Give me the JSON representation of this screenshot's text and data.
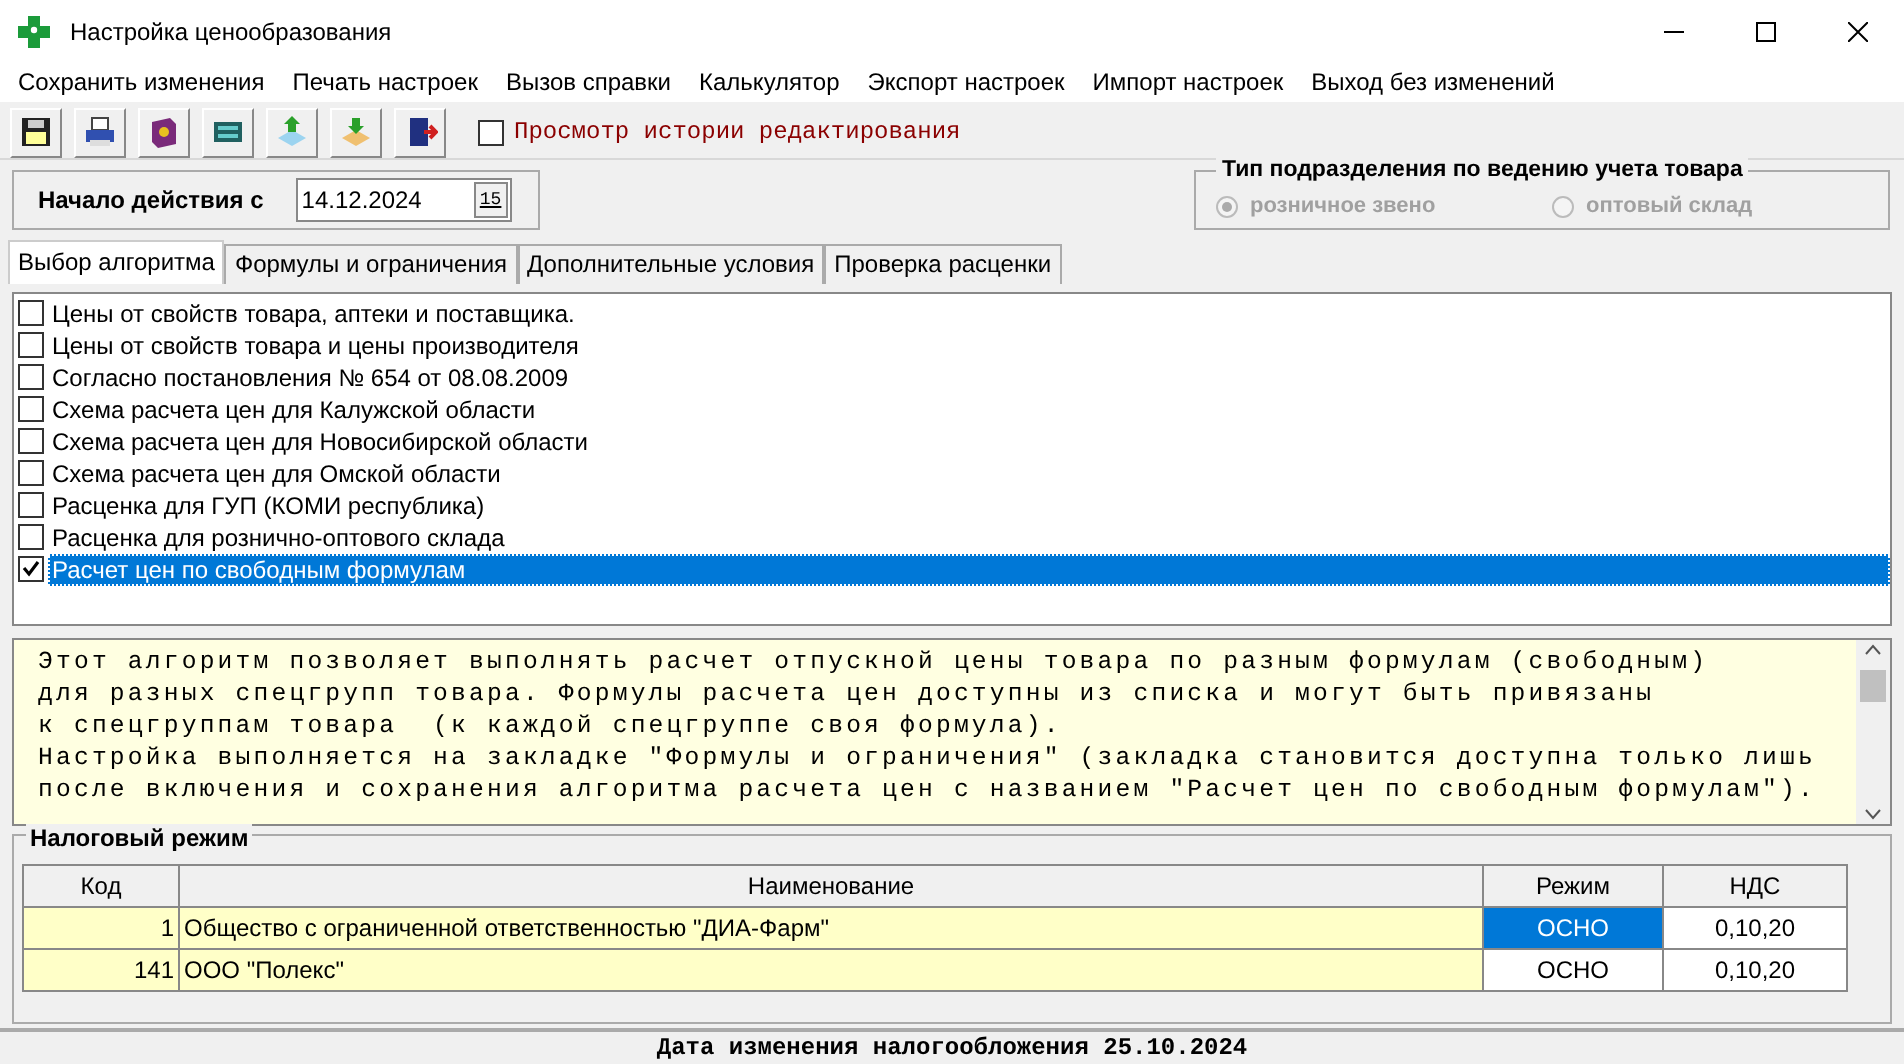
{
  "window": {
    "title": "Настройка ценообразования"
  },
  "menu": [
    "Сохранить изменения",
    "Печать настроек",
    "Вызов справки",
    "Калькулятор",
    "Экспорт настроек",
    "Импорт настроек",
    "Выход без изменений"
  ],
  "toolbar": {
    "history_checkbox": {
      "label": "Просмотр истории редактирования",
      "checked": false
    }
  },
  "start": {
    "label": "Начало действия с",
    "value": "14.12.2024",
    "calendar_button": "15"
  },
  "unit_type": {
    "title": "Тип подразделения по ведению учета товара",
    "disabled": true,
    "options": [
      {
        "label": "розничное звено",
        "selected": true
      },
      {
        "label": "оптовый склад",
        "selected": false
      }
    ]
  },
  "tabs": [
    {
      "label": "Выбор алгоритма",
      "selected": true
    },
    {
      "label": "Формулы и ограничения",
      "selected": false
    },
    {
      "label": "Дополнительные условия",
      "selected": false
    },
    {
      "label": "Проверка расценки",
      "selected": false
    }
  ],
  "algorithms": [
    {
      "label": "Цены от свойств товара, аптеки и поставщика.",
      "checked": false,
      "selected": false
    },
    {
      "label": "Цены от свойств товара и цены производителя",
      "checked": false,
      "selected": false
    },
    {
      "label": "Согласно постановления № 654 от 08.08.2009",
      "checked": false,
      "selected": false
    },
    {
      "label": "Схема расчета цен для Калужской области",
      "checked": false,
      "selected": false
    },
    {
      "label": "Схема расчета цен для Новосибирской области",
      "checked": false,
      "selected": false
    },
    {
      "label": "Схема расчета цен для Омской области",
      "checked": false,
      "selected": false
    },
    {
      "label": "Расценка для ГУП (КОМИ республика)",
      "checked": false,
      "selected": false
    },
    {
      "label": "Расценка для розничнo-оптового склада",
      "checked": false,
      "selected": false
    },
    {
      "label": "Расчет цен по свободным формулам",
      "checked": true,
      "selected": true
    }
  ],
  "description": "Этот алгоритм позволяет выполнять расчет отпускной цены товара по разным формулам (свободным)\nдля разных спецгрупп товара. Формулы расчета цен доступны из списка и могут быть привязаны\nк спецгруппам товара  (к каждой спецгруппе своя формула).\nНастройка выполняется на закладке \"Формулы и ограничения\" (закладка становится доступна только лишь\nпосле включения и сохранения алгоритма расчета цен с названием \"Расчет цен по свободным формулам\").",
  "tax": {
    "title": "Налоговый режим",
    "columns": [
      "Код",
      "Наименование",
      "Режим",
      "НДС"
    ],
    "rows": [
      {
        "code": "1",
        "name": "Общество с ограниченной ответственностью \"ДИА-Фарм\"",
        "mode": "ОСНО",
        "vat": "0,10,20",
        "mode_selected": true
      },
      {
        "code": "141",
        "name": "ООО \"Полекс\"",
        "mode": "ОСНО",
        "vat": "0,10,20",
        "mode_selected": false
      }
    ]
  },
  "status_bar": "Дата изменения налогообложения 25.10.2024"
}
